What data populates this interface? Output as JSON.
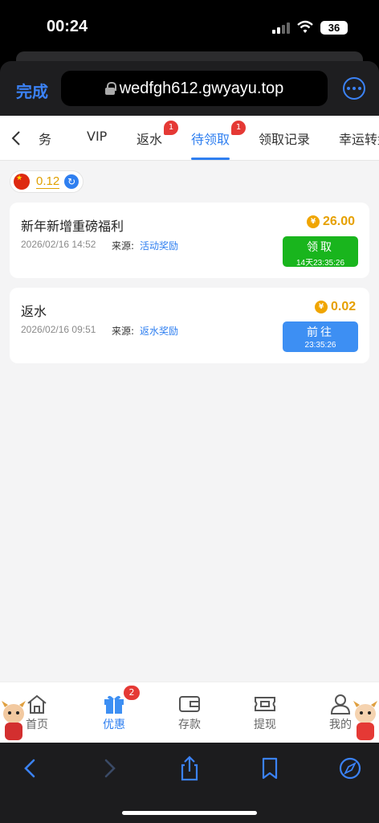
{
  "status_bar": {
    "time": "00:24",
    "battery": "36"
  },
  "browser": {
    "done_label": "完成",
    "url": "wedfgh612.gwyayu.top"
  },
  "tabs": [
    {
      "label": "任务",
      "display": "务"
    },
    {
      "label": "VIP"
    },
    {
      "label": "返水",
      "badge": "1"
    },
    {
      "label": "待领取",
      "badge": "1",
      "active": true
    },
    {
      "label": "领取记录"
    },
    {
      "label": "幸运转盘"
    }
  ],
  "balance": {
    "value": "0.12"
  },
  "rewards": [
    {
      "title": "新年新增重磅福利",
      "time": "2026/02/16 14:52",
      "source_label": "来源:",
      "source": "活动奖励",
      "amount": "26.00",
      "button_label": "领取",
      "countdown": "14天23:35:26",
      "button_color": "#19b51d"
    },
    {
      "title": "返水",
      "time": "2026/02/16 09:51",
      "source_label": "来源:",
      "source": "返水奖励",
      "amount": "0.02",
      "button_label": "前往",
      "countdown": "23:35:26",
      "button_color": "#3d8ff3"
    }
  ],
  "app_nav": [
    {
      "label": "首页",
      "icon": "home-icon"
    },
    {
      "label": "优惠",
      "icon": "gift-icon",
      "badge": "2",
      "active": true
    },
    {
      "label": "存款",
      "icon": "wallet-icon"
    },
    {
      "label": "提现",
      "icon": "withdraw-ticket-icon"
    },
    {
      "label": "我的",
      "icon": "profile-icon"
    }
  ],
  "safari_toolbar": [
    "back-arrow-icon",
    "forward-arrow-icon",
    "share-icon",
    "bookmarks-icon",
    "compass-icon"
  ],
  "colors": {
    "accent": "#2f7ff0",
    "amount": "#e6a000",
    "claim": "#19b51d",
    "goto": "#3d8ff3",
    "badge": "#e53935"
  }
}
